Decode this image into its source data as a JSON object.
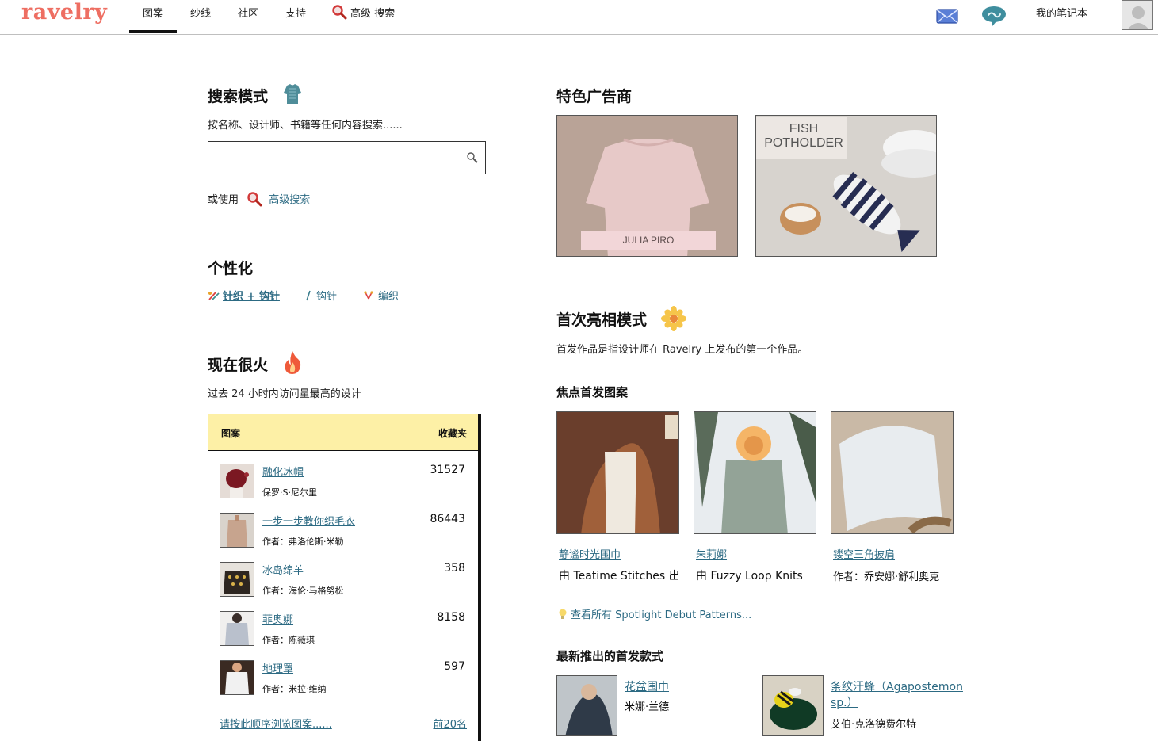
{
  "brand": {
    "logo_text": "ravelry",
    "logo_color": "#ee6e62",
    "link_color": "#2c6a83",
    "table_header_bg": "#fdf0a6"
  },
  "nav": {
    "items": [
      {
        "label": "图案",
        "active": true
      },
      {
        "label": "纱线"
      },
      {
        "label": "社区"
      },
      {
        "label": "支持"
      }
    ],
    "advanced_search_label": "高级 搜索",
    "notebook_label": "我的笔记本",
    "icons": [
      "envelope-icon",
      "chat-bubble-icon",
      "avatar"
    ]
  },
  "search": {
    "title": "搜索模式",
    "subtitle": "按名称、设计师、书籍等任何内容搜索......",
    "input_value": "",
    "or_use": "或使用",
    "advanced_link": "高级搜索"
  },
  "personalize": {
    "title": "个性化",
    "options": [
      {
        "label": "针织 + 钩针",
        "selected": true
      },
      {
        "label": "钩针",
        "selected": false
      },
      {
        "label": "编织",
        "selected": false
      }
    ]
  },
  "hot": {
    "title": "现在很火",
    "subtitle": "过去 24 小时内访问量最高的设计",
    "col_pattern": "图案",
    "col_favorites": "收藏夹",
    "rows": [
      {
        "title": "融化冰帽",
        "author": "保罗·S·尼尔里",
        "count": "31527"
      },
      {
        "title": "一步一步教你织毛衣",
        "author": "作者：弗洛伦斯·米勒",
        "count": "86443"
      },
      {
        "title": "冰岛绵羊",
        "author": "作者：海伦·马格努松",
        "count": "358"
      },
      {
        "title": "菲奥娜",
        "author": "作者：陈薇琪",
        "count": "8158"
      },
      {
        "title": "地理罩",
        "author": "作者：米拉·维纳",
        "count": "597"
      }
    ],
    "browse_link": "请按此顺序浏览图案......",
    "top20_link": "前20名"
  },
  "advertisers": {
    "title": "特色广告商",
    "ads": [
      {
        "caption": "JULIA PIRO"
      },
      {
        "caption_line1": "FISH",
        "caption_line2": "POTHOLDER"
      }
    ]
  },
  "debut": {
    "title": "首次亮相模式",
    "subtitle": "首发作品是指设计师在 Ravelry 上发布的第一个作品。",
    "spotlight_title": "焦点首发图案",
    "spotlight": [
      {
        "title": "静谧时光围巾",
        "by": "由 Teatime Stitches 出"
      },
      {
        "title": "朱莉娜",
        "by": "由 Fuzzy Loop Knits"
      },
      {
        "title": "镂空三角披肩",
        "by": "作者：乔安娜·舒利奥克"
      }
    ],
    "see_all": "查看所有 Spotlight Debut Patterns...",
    "newest_title": "最新推出的首发款式",
    "newest": [
      {
        "title": "花盆围巾",
        "by": "米娜·兰德"
      },
      {
        "title_line1": "条纹汗蜂（Agapostemon",
        "title_line2": "sp.）",
        "by": "艾伯·克洛德费尔特"
      }
    ]
  }
}
